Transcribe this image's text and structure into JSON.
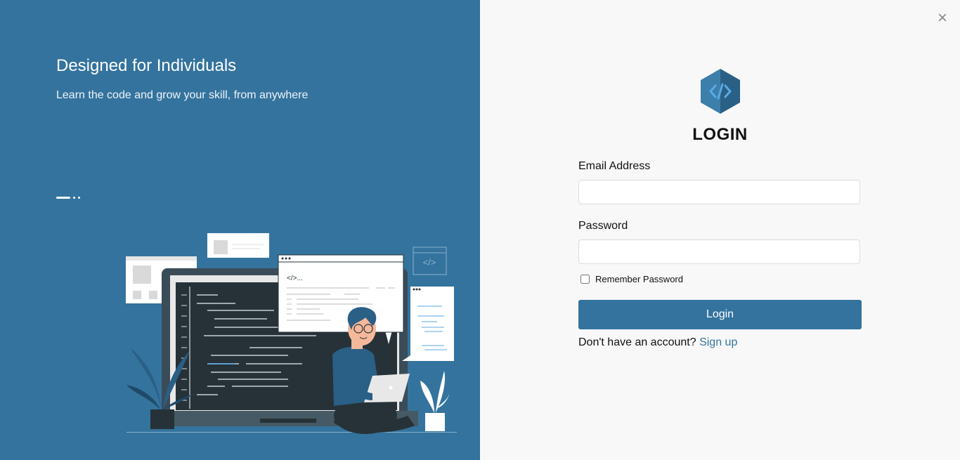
{
  "hero": {
    "title": "Designed for Individuals",
    "subtitle": "Learn the code and grow your skill, from anywhere",
    "carousel": {
      "count": 3,
      "active": 0
    },
    "illustration_code_text": "</>..."
  },
  "login": {
    "close_icon": "×",
    "logo_icon": "code-hexagon",
    "title": "LOGIN",
    "email_label": "Email Address",
    "email_value": "",
    "email_placeholder": "",
    "password_label": "Password",
    "password_value": "",
    "password_placeholder": "",
    "remember_label": "Remember Password",
    "remember_checked": false,
    "submit_label": "Login",
    "signup_prompt": "Don't have an account?",
    "signup_link": "Sign up"
  },
  "colors": {
    "brand": "#34739e",
    "panel_bg": "#f8f8f8",
    "logo_light": "#3d7fab",
    "logo_dark": "#2a5f86",
    "logo_code": "#5aa9e6"
  }
}
